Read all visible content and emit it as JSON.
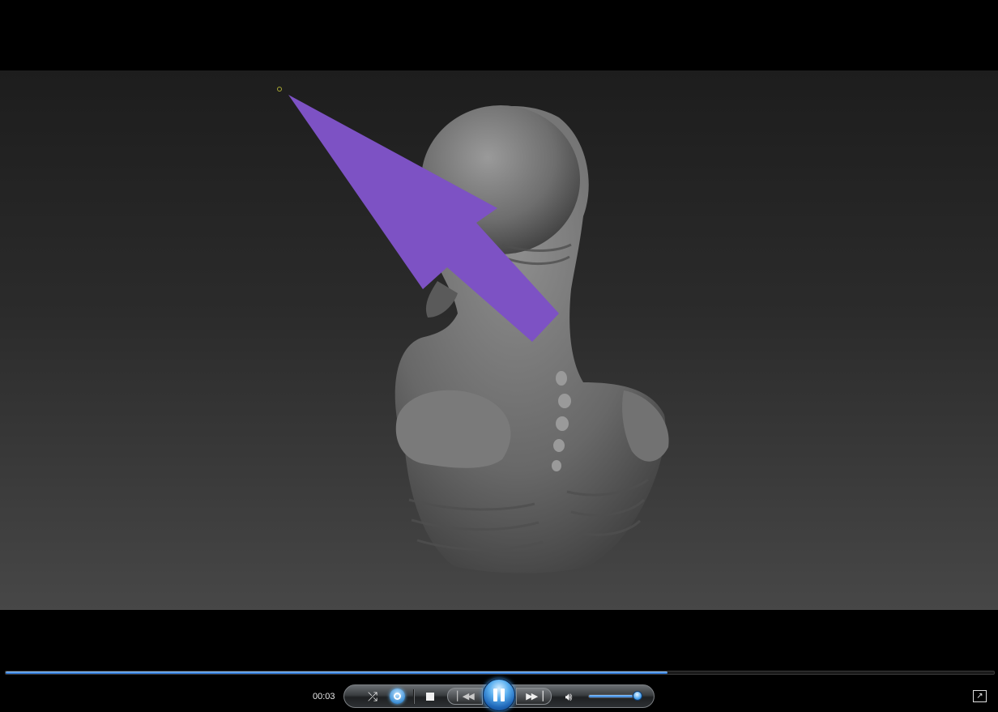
{
  "player": {
    "current_time": "00:03",
    "seek_progress": 0.67,
    "volume_level": 0.85,
    "state": "playing"
  },
  "controls": {
    "shuffle_icon": "shuffle-icon",
    "repeat_icon": "repeat-icon",
    "stop_icon": "stop-icon",
    "previous_icon": "previous-icon",
    "play_pause_icon": "pause-icon",
    "next_icon": "next-icon",
    "mute_icon": "speaker-icon",
    "switch_view_icon": "switch-to-library-icon"
  },
  "colors": {
    "accent": "#3b86e0",
    "annotation_arrow": "#7d52c4",
    "viewport_top": "#1d1d1d",
    "viewport_bottom": "#474747"
  }
}
